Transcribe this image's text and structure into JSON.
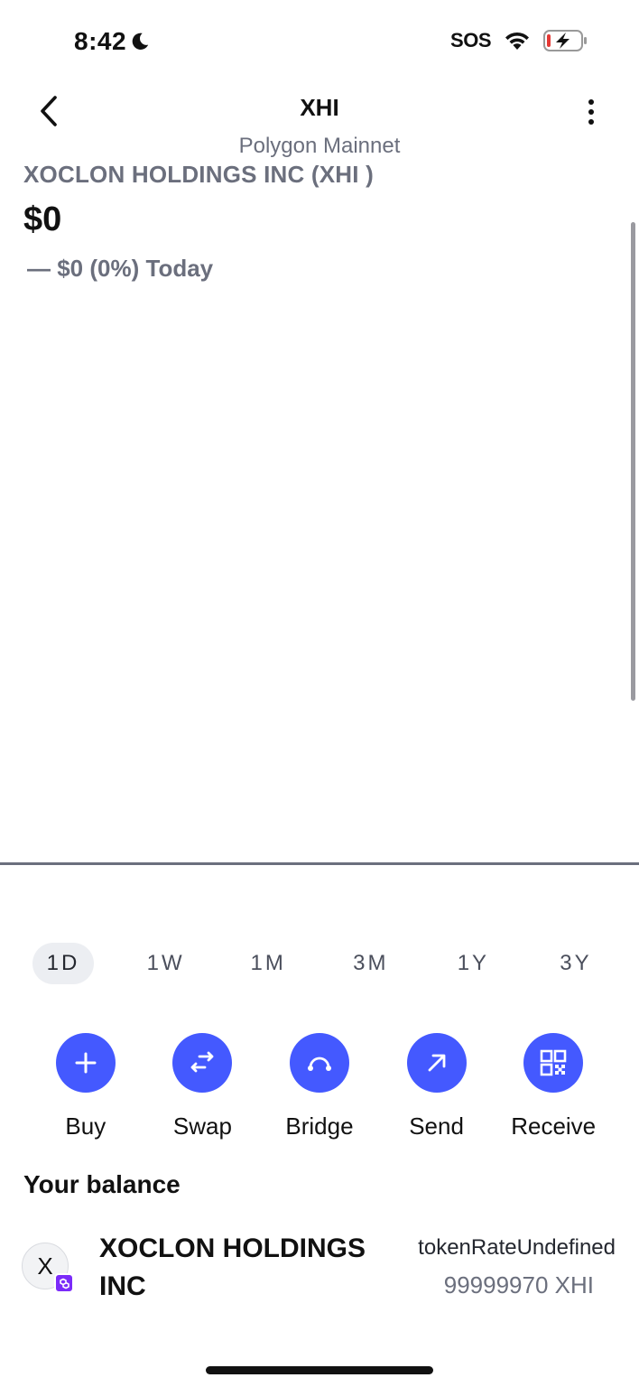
{
  "status_bar": {
    "time": "8:42",
    "carrier": "SOS"
  },
  "header": {
    "title": "XHI",
    "subtitle": "Polygon Mainnet"
  },
  "token": {
    "full_name": "XOCLON HOLDINGS INC (XHI )",
    "price": "$0",
    "change": "— $0 (0%) Today"
  },
  "ranges": [
    "1D",
    "1W",
    "1M",
    "3M",
    "1Y",
    "3Y"
  ],
  "active_range": "1D",
  "actions": {
    "buy": "Buy",
    "swap": "Swap",
    "bridge": "Bridge",
    "send": "Send",
    "receive": "Receive"
  },
  "balance": {
    "title": "Your balance",
    "asset": {
      "avatar_letter": "X",
      "name": "XOCLON HOLDINGS INC",
      "rate": "tokenRateUndefined",
      "amount": "99999970 XHI"
    }
  },
  "colors": {
    "accent": "#4459ff",
    "muted": "#6b6f7d",
    "badge": "#7b2bf9"
  },
  "icons": [
    "moon-icon",
    "wifi-icon",
    "battery-charging-icon",
    "back-chevron-icon",
    "more-vertical-icon",
    "plus-icon",
    "swap-arrows-icon",
    "bridge-icon",
    "send-arrow-icon",
    "qr-code-icon",
    "polygon-badge-icon"
  ]
}
